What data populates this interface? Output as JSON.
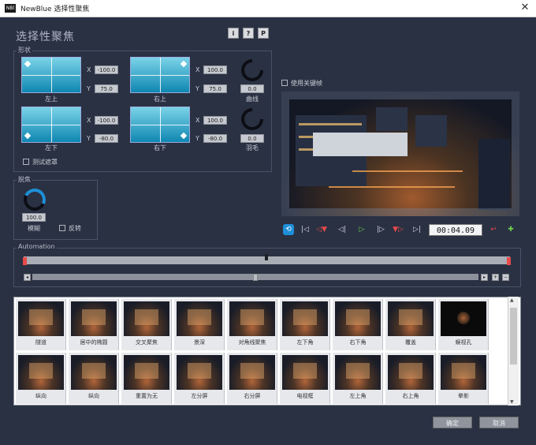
{
  "window": {
    "logo": "NBl",
    "title": "NewBlue 选择性聚焦",
    "close": "✕"
  },
  "effect_title": "选择性聚焦",
  "help_buttons": [
    "i",
    "?",
    "P"
  ],
  "shape": {
    "group_label": "形状",
    "top_left": {
      "label": "左上",
      "x": "-100.0",
      "y": "75.0"
    },
    "top_right": {
      "label": "右上",
      "x": "100.0",
      "y": "75.0"
    },
    "bottom_left": {
      "label": "左下",
      "x": "-100.0",
      "y": "-80.0"
    },
    "bottom_right": {
      "label": "右下",
      "x": "100.0",
      "y": "-80.0"
    },
    "curve": {
      "label": "曲线",
      "value": "0.0"
    },
    "feather": {
      "label": "羽毛",
      "value": "0.0"
    },
    "test_mask": "测试遮罩",
    "x_label": "X",
    "y_label": "Y"
  },
  "defocus": {
    "group_label": "脱焦",
    "blur_label": "模糊",
    "blur_value": "100.0",
    "invert_label": "反转"
  },
  "use_keyframes": "使用关键帧",
  "transport": {
    "timecode": "00:04.09",
    "loop": "⟲",
    "to_start": "|◁",
    "prev_kf": "◁▼",
    "step_back": "◁|",
    "play": "▷",
    "step_fwd": "|▷",
    "next_kf": "▼▷",
    "to_end": "▷|",
    "del_kf": "↩",
    "add_kf": "✚"
  },
  "automation": {
    "label": "Automation",
    "plus": "+",
    "minus": "−"
  },
  "presets": [
    {
      "label": "隧道",
      "dark": false
    },
    {
      "label": "居中的椭圆",
      "dark": false
    },
    {
      "label": "交叉聚焦",
      "dark": false
    },
    {
      "label": "景深",
      "dark": false
    },
    {
      "label": "对角线聚焦",
      "dark": false
    },
    {
      "label": "左下角",
      "dark": false
    },
    {
      "label": "右下角",
      "dark": false
    },
    {
      "label": "覆盖",
      "dark": false
    },
    {
      "label": "蜈视孔",
      "dark": true
    },
    {
      "label": "纵向",
      "dark": false
    },
    {
      "label": "纵向",
      "dark": false
    },
    {
      "label": "重置为无",
      "dark": false
    },
    {
      "label": "左分屏",
      "dark": false
    },
    {
      "label": "右分屏",
      "dark": false
    },
    {
      "label": "电视框",
      "dark": false
    },
    {
      "label": "左上角",
      "dark": false
    },
    {
      "label": "右上角",
      "dark": false
    },
    {
      "label": "晕影",
      "dark": false
    }
  ],
  "buttons": {
    "ok": "确定",
    "cancel": "取消"
  }
}
